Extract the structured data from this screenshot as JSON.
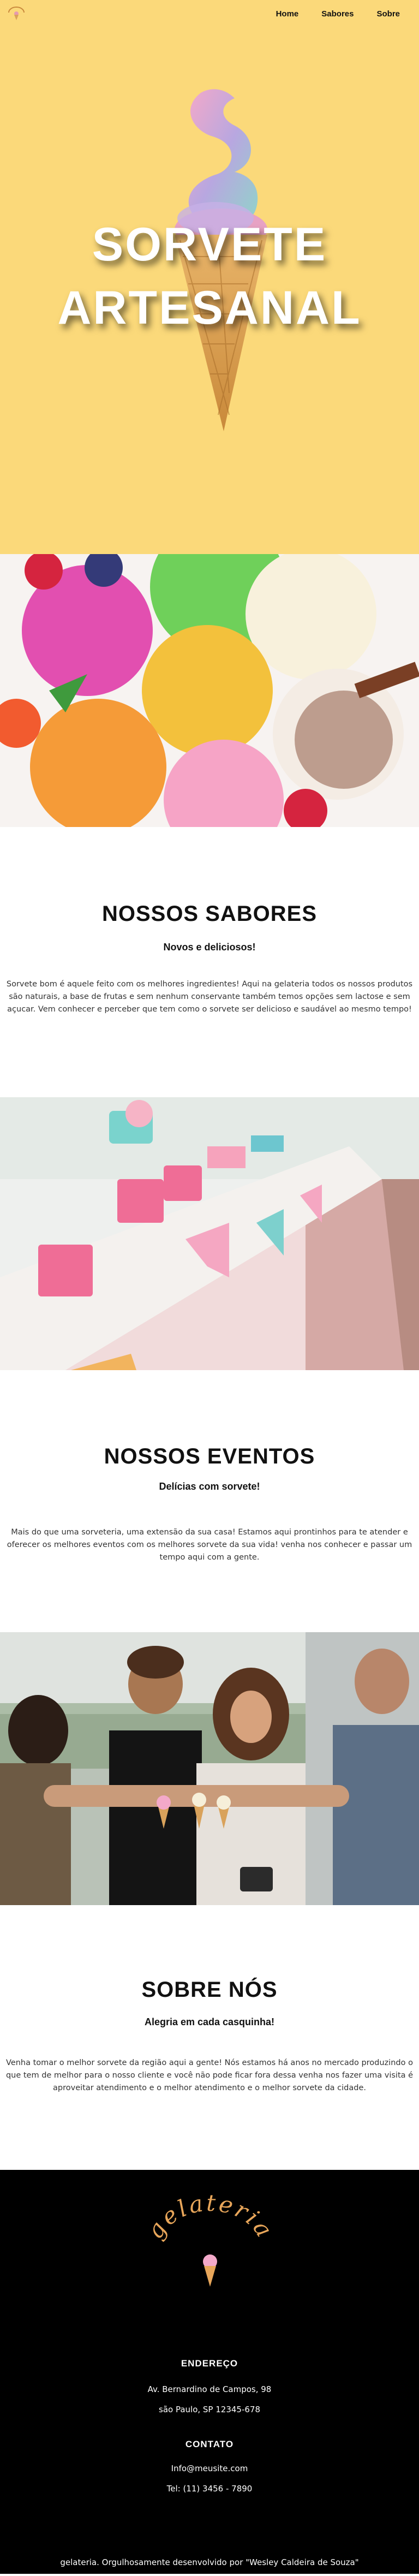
{
  "nav": {
    "links": [
      "Home",
      "Sabores",
      "Sobre"
    ]
  },
  "hero": {
    "title": "SORVETE\nARTESANAL",
    "background": "#fbd97a"
  },
  "sabores": {
    "title": "NOSSOS SABORES",
    "subtitle": "Novos e deliciosos!",
    "text": "Sorvete bom é aquele feito com os melhores ingredientes! Aqui na gelateria todos os nossos produtos são naturais, a base de frutas e sem nenhum conservante também temos opções sem lactose e sem açucar. Vem conhecer e perceber que tem como o sorvete ser delicioso e saudável ao mesmo tempo!"
  },
  "eventos": {
    "title": "NOSSOS EVENTOS",
    "subtitle": "Delícias com sorvete!",
    "text": "Mais do que uma sorveteria, uma extensão da sua casa! Estamos aqui prontinhos para te atender e oferecer os melhores eventos com os melhores sorvete da sua vida! venha nos conhecer e passar um tempo aqui com a gente."
  },
  "sobre": {
    "title": "SOBRE NÓS",
    "subtitle": "Alegria em cada casquinha!",
    "text": "Venha tomar o melhor sorvete da região aqui a gente! Nós estamos há anos no mercado produzindo o que tem de melhor para o nosso cliente e você não pode ficar fora dessa venha nos fazer uma visita é aproveitar atendimento e o melhor atendimento e o melhor sorvete da cidade."
  },
  "footer": {
    "logo_text": "gelateria",
    "address_heading": "ENDEREÇO",
    "address_line1": "Av. Bernardino de Campos, 98",
    "address_line2": "são Paulo, SP 12345-678",
    "contact_heading": "CONTATO",
    "email": "Info@meusite.com",
    "phone": "Tel: (11) 3456 - 7890",
    "credit": "gelateria. Orgulhosamente desenvolvido por \"Wesley Caldeira de Souza\"",
    "accent": "#e8a65a"
  }
}
